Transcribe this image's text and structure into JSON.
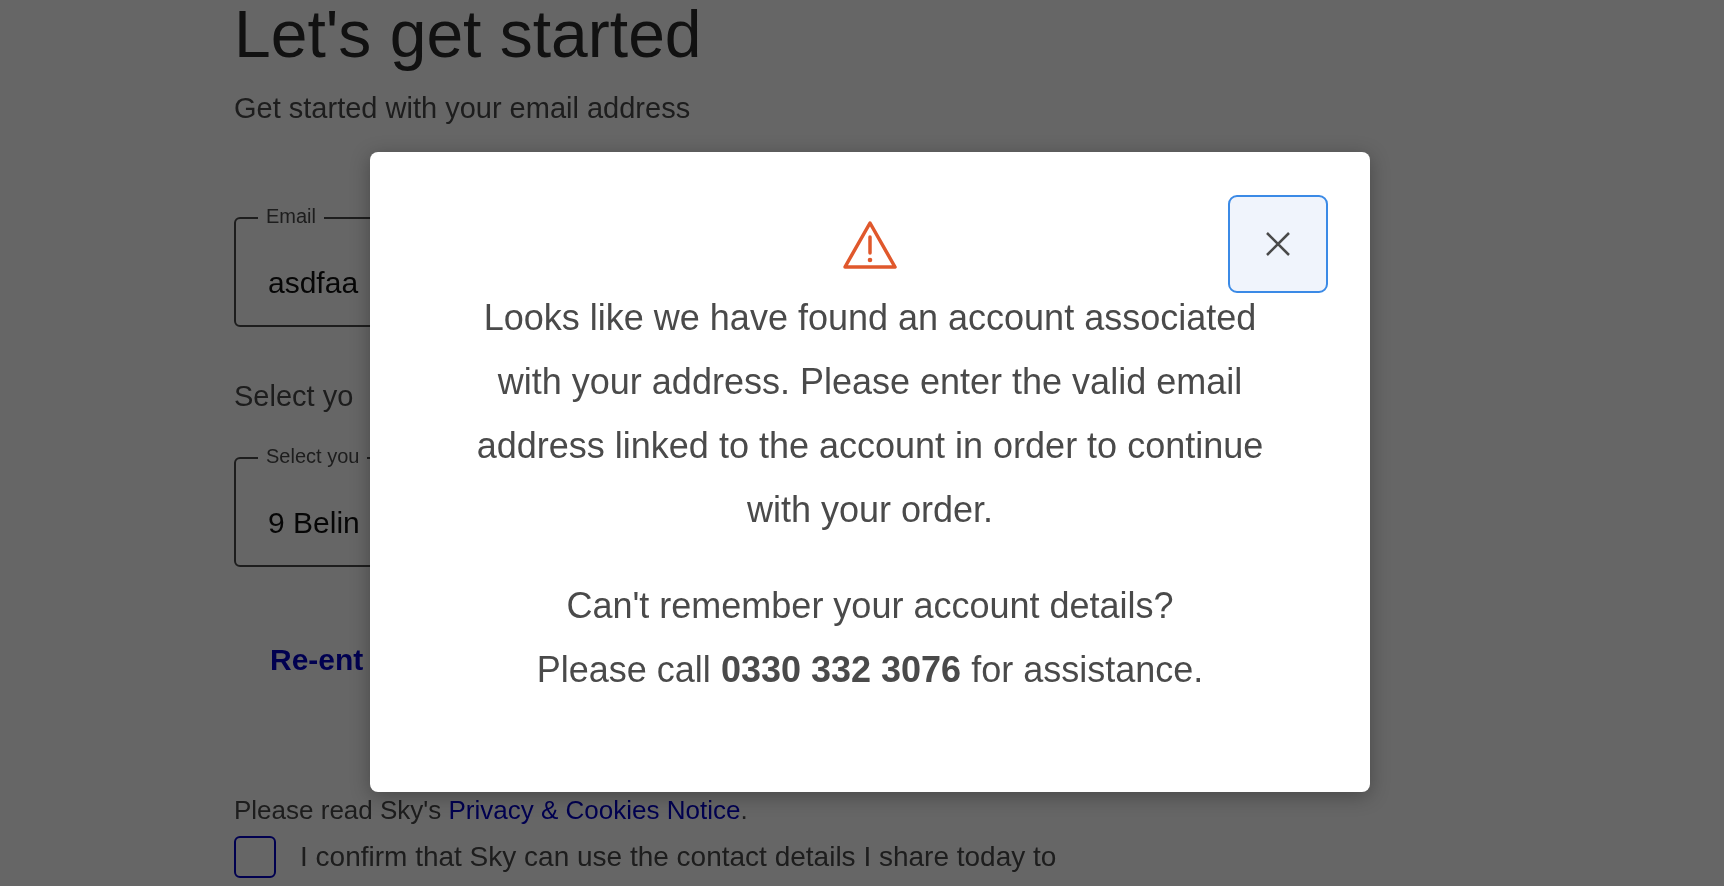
{
  "page": {
    "title": "Let's get started",
    "email_prompt": "Get started with your email address",
    "email_field": {
      "label": "Email",
      "value": "asdfaa"
    },
    "address_prompt": "Select yo",
    "address_field": {
      "label": "Select you",
      "value": "9 Belin"
    },
    "reenter_link": "Re-ent",
    "privacy": {
      "text": "Please read Sky's",
      "link": "Privacy & Cookies Notice",
      "end": "."
    },
    "consent": {
      "checked": false,
      "text": "I confirm that Sky can use the contact details I share today to"
    }
  },
  "modal": {
    "message": "Looks like we have found an account associated with your address. Please enter the valid email address linked to the account in order to continue with your order.",
    "help": "Can't remember your account details?",
    "call": "Please call **0330 332 3076** for assistance."
  }
}
